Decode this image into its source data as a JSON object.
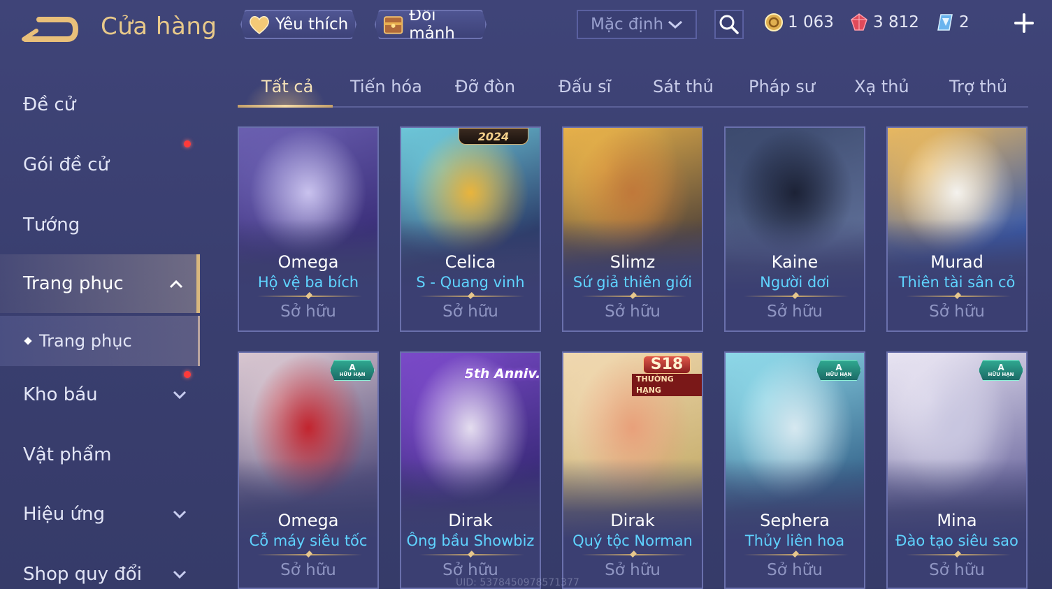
{
  "header": {
    "title": "Cửa hàng",
    "favorite_label": "Yêu thích",
    "trade_label": "Đổi mảnh",
    "sort_value": "Mặc định",
    "currencies": [
      {
        "name": "gold-coin-icon",
        "value": "1 063"
      },
      {
        "name": "ruby-icon",
        "value": "3 812"
      },
      {
        "name": "ticket-icon",
        "value": "2"
      }
    ]
  },
  "sidebar": {
    "items": [
      {
        "label": "Đề cử"
      },
      {
        "label": "Gói đề cử"
      },
      {
        "label": "Tướng"
      },
      {
        "label": "Trang phục"
      },
      {
        "label": "Trang phục"
      },
      {
        "label": "Kho báu"
      },
      {
        "label": "Vật phẩm"
      },
      {
        "label": "Hiệu ứng"
      },
      {
        "label": "Shop quy đổi"
      }
    ]
  },
  "tabs": [
    "Tất cả",
    "Tiến hóa",
    "Đỡ đòn",
    "Đấu sĩ",
    "Sát thủ",
    "Pháp sư",
    "Xạ thủ",
    "Trợ thủ"
  ],
  "cards": [
    {
      "hero": "Omega",
      "skin": "Hộ vệ ba bích",
      "status": "Sở hữu",
      "colors": [
        "#6a5fb0",
        "#c9c2ee",
        "#3b2f7a"
      ]
    },
    {
      "hero": "Celica",
      "skin": "S - Quang vinh",
      "status": "Sở hữu",
      "colors": [
        "#6dc6d8",
        "#e9b43c",
        "#2b3d6a"
      ],
      "badge": "2024"
    },
    {
      "hero": "Slimz",
      "skin": "Sứ giả thiên giới",
      "status": "Sở hữu",
      "colors": [
        "#e7b14a",
        "#c0783a",
        "#5a4a3a"
      ]
    },
    {
      "hero": "Kaine",
      "skin": "Người dơi",
      "status": "Sở hữu",
      "colors": [
        "#3c4a6e",
        "#1c2236",
        "#5c6c94"
      ]
    },
    {
      "hero": "Murad",
      "skin": "Thiên tài sân cỏ",
      "status": "Sở hữu",
      "colors": [
        "#e8b860",
        "#f4f2ee",
        "#3a5aa8"
      ]
    },
    {
      "hero": "Omega",
      "skin": "Cỗ máy siêu tốc",
      "status": "Sở hữu",
      "colors": [
        "#d8c6d0",
        "#c2242e",
        "#5a5480"
      ],
      "badge": "A",
      "badge_sub": "HỮU HẠN"
    },
    {
      "hero": "Dirak",
      "skin": "Ông bầu Showbiz",
      "status": "Sở hữu",
      "colors": [
        "#7a4ac8",
        "#e4ddef",
        "#3a2a7a"
      ],
      "badge": "5th Anniv."
    },
    {
      "hero": "Dirak",
      "skin": "Quý tộc Norman",
      "status": "Sở hữu",
      "colors": [
        "#f0d8b0",
        "#e8a07a",
        "#c8b070"
      ],
      "badge": "S18",
      "badge_sub": "THƯỜNG HẠNG"
    },
    {
      "hero": "Sephera",
      "skin": "Thủy liên hoa",
      "status": "Sở hữu",
      "colors": [
        "#8ed8e8",
        "#d6e8f0",
        "#3a6a90"
      ],
      "badge": "A",
      "badge_sub": "HỮU HẠN"
    },
    {
      "hero": "Mina",
      "skin": "Đào tạo siêu sao",
      "status": "Sở hữu",
      "colors": [
        "#e8e4f2",
        "#c8c6e0",
        "#7a76a8"
      ],
      "badge": "A",
      "badge_sub": "HỮU HẠN"
    }
  ],
  "footer": {
    "uid": "UID: 5378450978571377"
  }
}
